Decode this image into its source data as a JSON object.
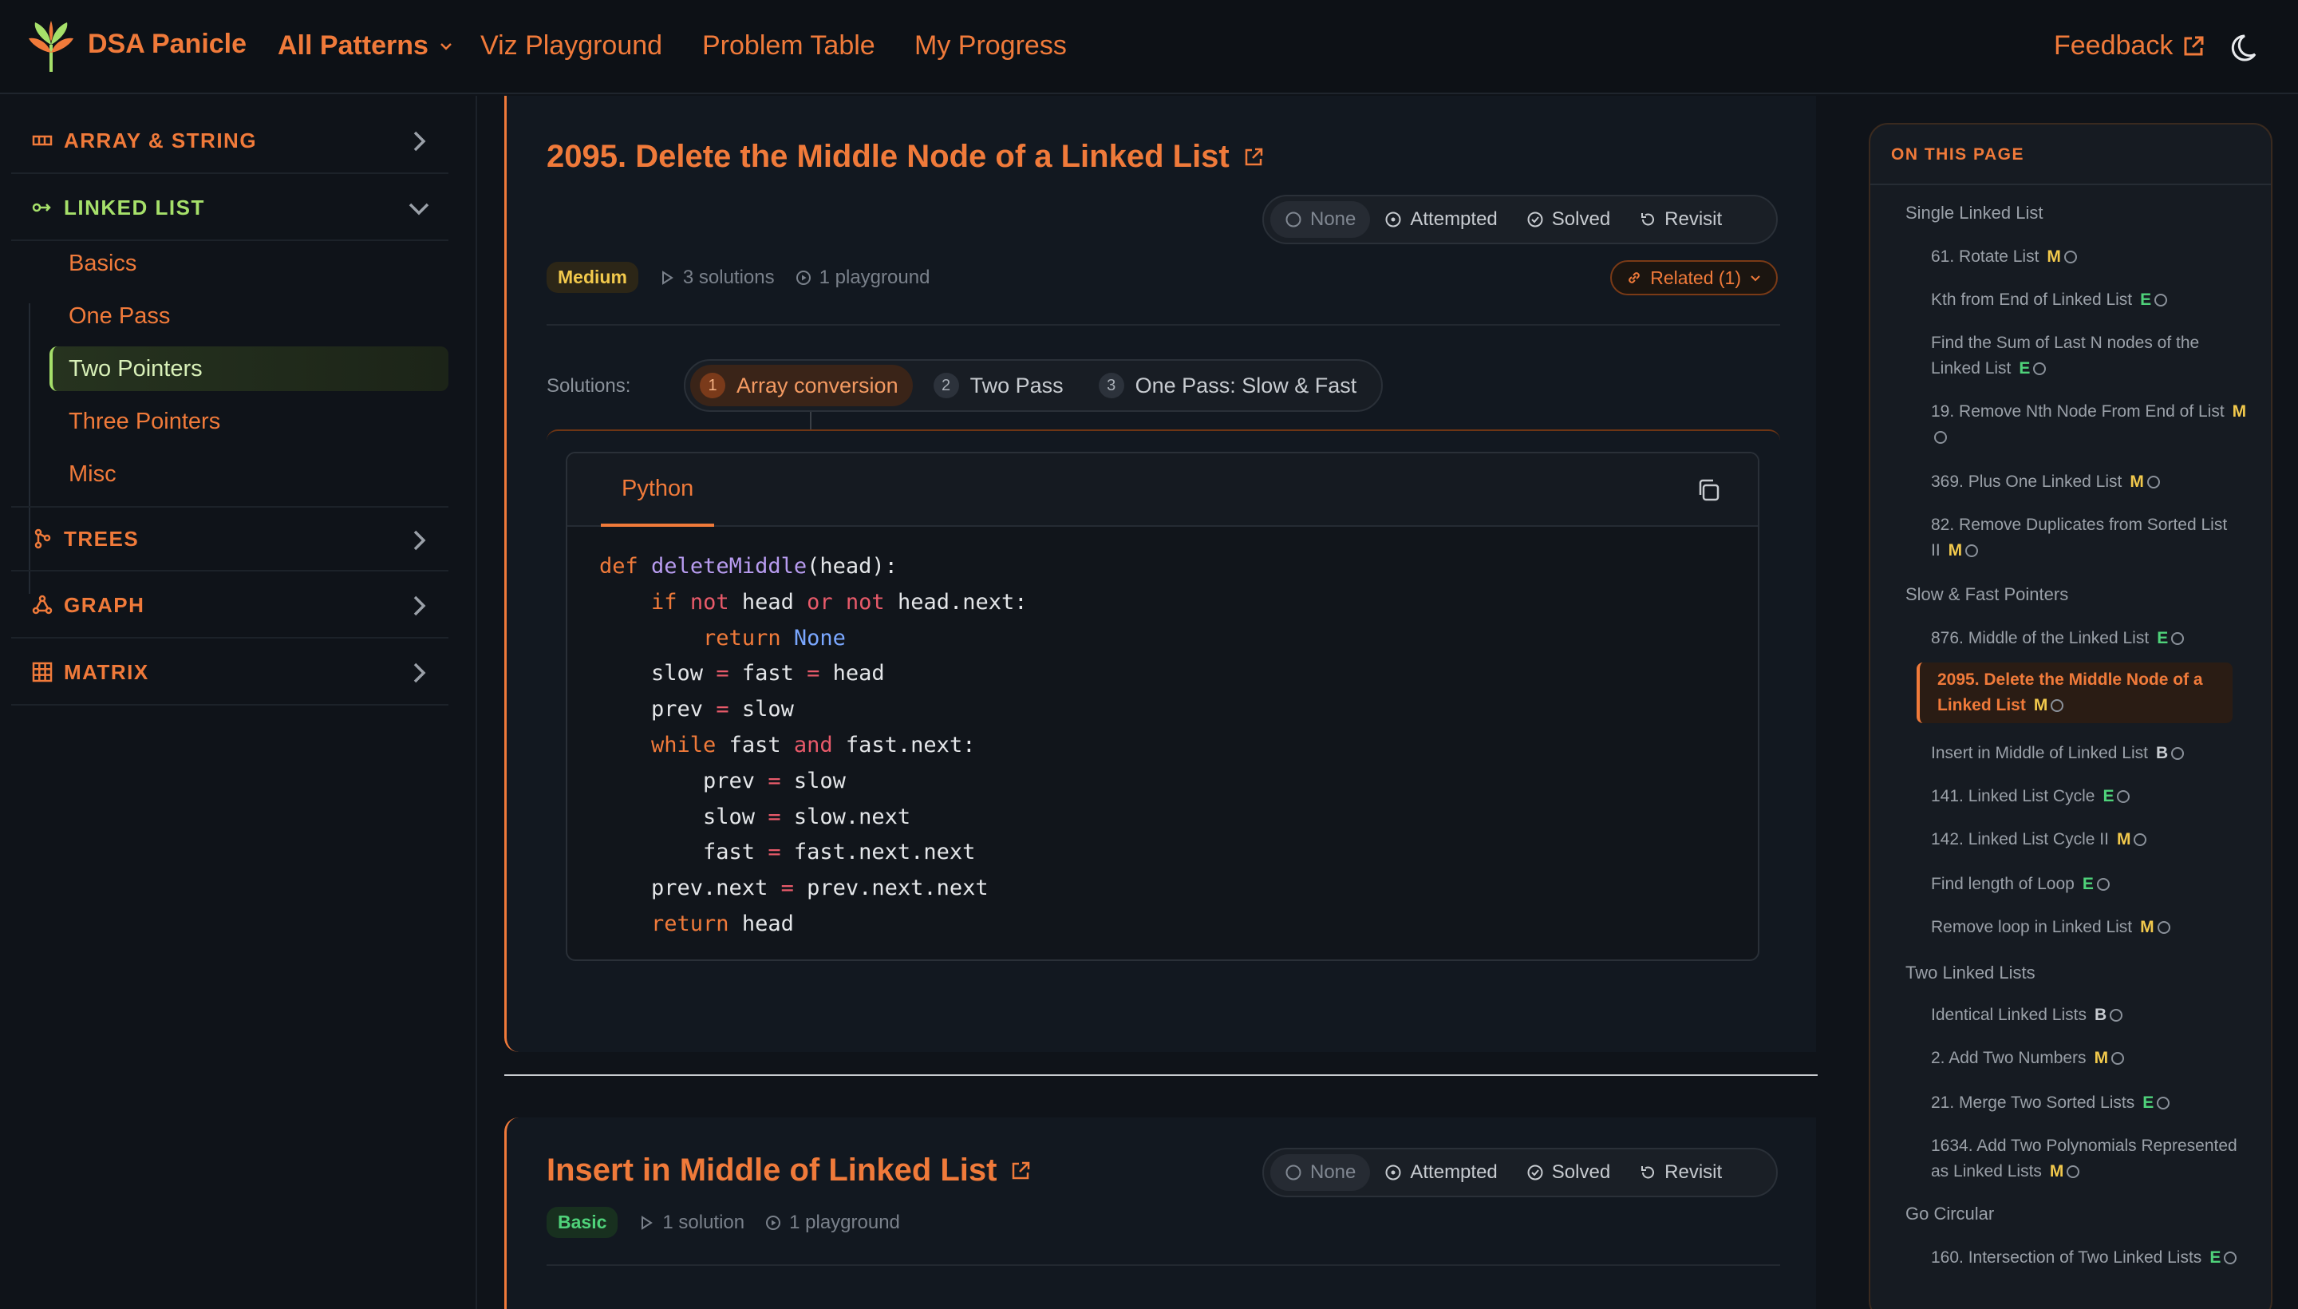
{
  "header": {
    "brand": "DSA Panicle",
    "nav": {
      "all_patterns": "All Patterns",
      "viz_playground": "Viz Playground",
      "problem_table": "Problem Table",
      "my_progress": "My Progress"
    },
    "feedback": "Feedback"
  },
  "sidebar": {
    "sections": [
      {
        "label": "ARRAY & STRING",
        "icon": "array-icon",
        "expanded": false
      },
      {
        "label": "LINKED LIST",
        "icon": "linked-list-icon",
        "expanded": true
      },
      {
        "label": "TREES",
        "icon": "tree-icon",
        "expanded": false
      },
      {
        "label": "GRAPH",
        "icon": "graph-icon",
        "expanded": false
      },
      {
        "label": "MATRIX",
        "icon": "matrix-icon",
        "expanded": false
      }
    ],
    "linked_list_items": [
      "Basics",
      "One Pass",
      "Two Pointers",
      "Three Pointers",
      "Misc"
    ],
    "active_item": "Two Pointers"
  },
  "problem1": {
    "title": "2095. Delete the Middle Node of a Linked List",
    "status_options": [
      "None",
      "Attempted",
      "Solved",
      "Revisit"
    ],
    "selected_status": "None",
    "difficulty": "Medium",
    "solutions_count": "3 solutions",
    "playground_count": "1 playground",
    "related": "Related (1)",
    "solutions_label": "Solutions:",
    "solutions": [
      {
        "num": "1",
        "label": "Array conversion"
      },
      {
        "num": "2",
        "label": "Two Pass"
      },
      {
        "num": "3",
        "label": "One Pass: Slow & Fast"
      }
    ],
    "active_solution": "Array conversion",
    "language": "Python"
  },
  "problem2": {
    "title": "Insert in Middle of Linked List",
    "status_options": [
      "None",
      "Attempted",
      "Solved",
      "Revisit"
    ],
    "selected_status": "None",
    "difficulty": "Basic",
    "solutions_count": "1 solution",
    "playground_count": "1 playground"
  },
  "toc": {
    "heading": "ON THIS PAGE",
    "groups": [
      {
        "title": "Single Linked List",
        "items": [
          {
            "text": "61. Rotate List",
            "badge": "M"
          },
          {
            "text": "Kth from End of Linked List",
            "badge": "E"
          },
          {
            "text": "Find the Sum of Last N nodes of the Linked List",
            "badge": "E"
          },
          {
            "text": "19. Remove Nth Node From End of List",
            "badge": "M"
          },
          {
            "text": "369. Plus One Linked List",
            "badge": "M"
          },
          {
            "text": "82. Remove Duplicates from Sorted List II",
            "badge": "M"
          }
        ]
      },
      {
        "title": "Slow & Fast Pointers",
        "items": [
          {
            "text": "876. Middle of the Linked List",
            "badge": "E"
          },
          {
            "text": "2095. Delete the Middle Node of a Linked List",
            "badge": "M",
            "active": true
          },
          {
            "text": "Insert in Middle of Linked List",
            "badge": "B"
          },
          {
            "text": "141. Linked List Cycle",
            "badge": "E"
          },
          {
            "text": "142. Linked List Cycle II",
            "badge": "M"
          },
          {
            "text": "Find length of Loop",
            "badge": "E"
          },
          {
            "text": "Remove loop in Linked List",
            "badge": "M"
          }
        ]
      },
      {
        "title": "Two Linked Lists",
        "items": [
          {
            "text": "Identical Linked Lists",
            "badge": "B"
          },
          {
            "text": "2. Add Two Numbers",
            "badge": "M"
          },
          {
            "text": "21. Merge Two Sorted Lists",
            "badge": "E"
          },
          {
            "text": "1634. Add Two Polynomials Represented as Linked Lists",
            "badge": "M"
          }
        ]
      },
      {
        "title": "Go Circular",
        "items": [
          {
            "text": "160. Intersection of Two Linked Lists",
            "badge": "E"
          }
        ]
      }
    ]
  },
  "colors": {
    "accent": "#f07a3a",
    "active_green": "#a6e06a",
    "medium": "#f2c94c",
    "easy": "#4fd27a"
  }
}
